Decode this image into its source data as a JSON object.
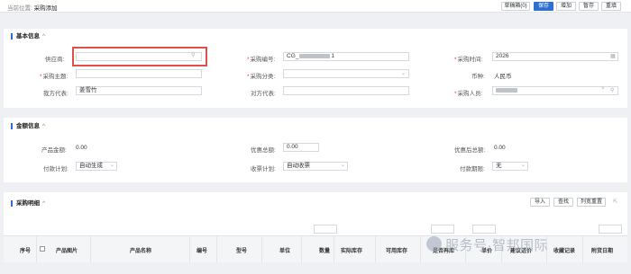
{
  "breadcrumb": {
    "prefix": "当前位置:",
    "current": "采购添加"
  },
  "toolbar": {
    "draft": "草稿箱(0)",
    "save": "保存",
    "add": "增加",
    "hold": "暂存",
    "reset": "重填"
  },
  "basic": {
    "title": "基本信息",
    "collapse_icon": "chevron-up-icon",
    "supplier_label": "供应商:",
    "supplier_value": "",
    "search_icon": "search-icon",
    "code_label": "采购编号:",
    "code_value_prefix": "CG_",
    "code_value_suffix": "1",
    "time_label": "采购时间:",
    "time_value": "2026",
    "calendar_icon": "calendar-icon",
    "subject_label": "采购主题:",
    "subject_value": "",
    "category_label": "采购分类:",
    "category_value": "",
    "currency_label": "币种:",
    "currency_value": "人民币",
    "our_rep_label": "我方代表:",
    "our_rep_value": "姜雪竹",
    "their_rep_label": "对方代表:",
    "their_rep_value": "",
    "buyer_label": "采购人员:",
    "buyer_value": "",
    "clear_icon": "clear-icon"
  },
  "amount": {
    "title": "金额信息",
    "product_amount_label": "产品金额:",
    "product_amount_value": "0.00",
    "discount_label": "优惠总额:",
    "discount_value": "0.00",
    "after_discount_label": "优惠后总额:",
    "after_discount_value": "0.00",
    "pay_plan_label": "付款计划:",
    "pay_plan_value": "自动生成",
    "receive_plan_label": "收票计划:",
    "receive_plan_value": "自动收票",
    "pay_period_label": "付款期限:",
    "pay_period_value": "无"
  },
  "detail": {
    "title": "采购明细",
    "import_button": "导入",
    "search_button": "查找",
    "column_reset_button": "列宽重置",
    "expand_icon": "expand-icon",
    "columns": [
      "序号",
      "产品图片",
      "产品名称",
      "编号",
      "型号",
      "单位",
      "数量",
      "实际库存",
      "可用库存",
      "是否再库",
      "单价",
      "建议进价",
      "收藏记录",
      "附货日期"
    ]
  },
  "watermark": "服务号·智邦国际",
  "colors": {
    "primary": "#2f6fd0",
    "required": "#e04040",
    "highlight": "#e0504b"
  }
}
